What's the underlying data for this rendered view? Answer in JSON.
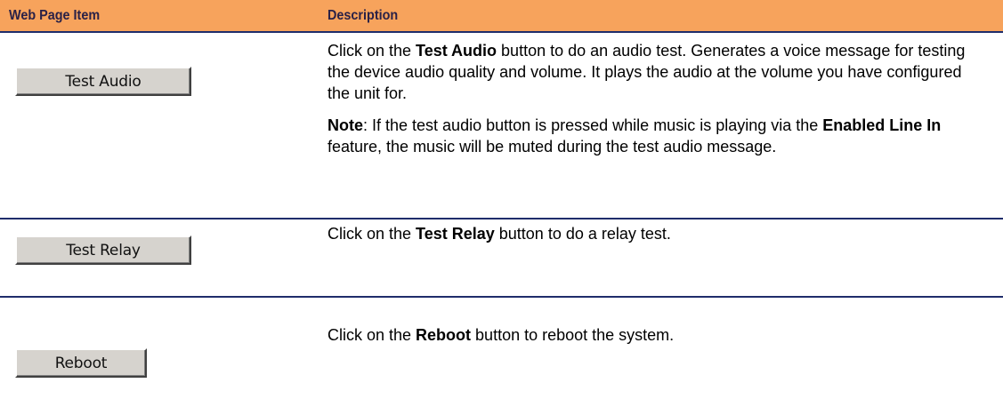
{
  "header": {
    "col1": "Web Page Item",
    "col2": "Description"
  },
  "rows": [
    {
      "button_label": "Test Audio",
      "paragraphs": [
        [
          {
            "t": "Click on the "
          },
          {
            "t": "Test Audio",
            "b": true
          },
          {
            "t": " button to do an audio test. Generates a voice message for testing the device audio quality and volume. It plays the audio at the volume you have configured the unit for."
          }
        ],
        [
          {
            "t": "Note",
            "b": true
          },
          {
            "t": ": If the test audio button is pressed while music is playing via the "
          },
          {
            "t": "Enabled Line In",
            "b": true
          },
          {
            "t": " feature, the music will be muted during the test audio message."
          }
        ]
      ]
    },
    {
      "button_label": "Test Relay",
      "paragraphs": [
        [
          {
            "t": "Click on the "
          },
          {
            "t": "Test Relay",
            "b": true
          },
          {
            "t": " button to do a relay test."
          }
        ]
      ]
    },
    {
      "button_label": "Reboot",
      "paragraphs": [
        [
          {
            "t": "Click on the "
          },
          {
            "t": "Reboot",
            "b": true
          },
          {
            "t": " button to reboot the system."
          }
        ]
      ]
    }
  ]
}
